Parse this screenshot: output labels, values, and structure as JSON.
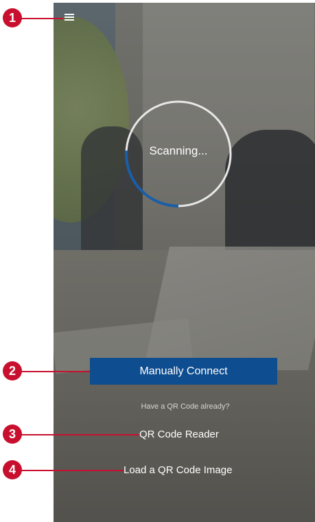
{
  "app": {
    "menu_icon": "hamburger-menu-icon"
  },
  "scan": {
    "status_text": "Scanning...",
    "progress": 0.26,
    "ring_color": "#e8e8e8",
    "progress_color": "#1a5ea8"
  },
  "actions": {
    "manual_connect_label": "Manually Connect",
    "qr_prompt": "Have a QR Code already?",
    "qr_reader_label": "QR Code Reader",
    "load_qr_image_label": "Load a QR Code Image"
  },
  "callouts": [
    "1",
    "2",
    "3",
    "4"
  ],
  "colors": {
    "primary_button": "#0e4d8f",
    "callout_red": "#c8102e"
  }
}
